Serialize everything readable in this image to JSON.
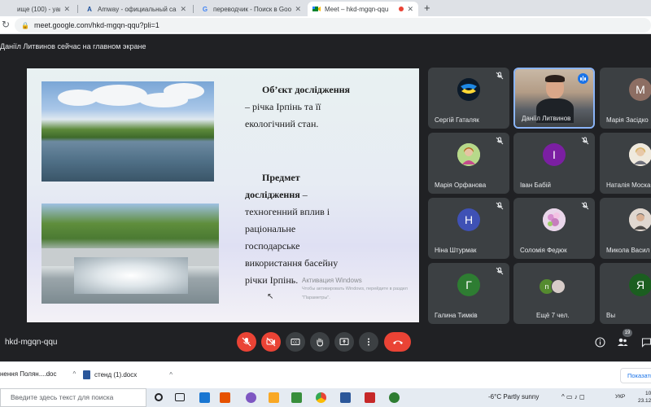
{
  "browser": {
    "tabs": [
      {
        "label": "ище (100) - yarad1964@g",
        "active": false
      },
      {
        "label": "Amway - официальный сайт и",
        "active": false
      },
      {
        "label": "переводчик - Поиск в Google",
        "active": false
      },
      {
        "label": "Meet – hkd-mgqn-qqu",
        "active": true
      }
    ],
    "url": "meet.google.com/hkd-mgqn-qqu?pli=1"
  },
  "meet": {
    "presenter_notice": "Даніїл Литвинов сейчас на главном экране",
    "meeting_code": "hkd-mgqn-qqu",
    "people_count": "19"
  },
  "slide": {
    "object_title": "Об’єкт дослідження",
    "object_lines": [
      "– річка Ірпінь та її",
      "екологічний стан."
    ],
    "subject_title": "Предмет",
    "subject_line1_bold": "дослідження",
    "subject_line1_rest": " –",
    "subject_lines": [
      "техногенний вплив і",
      "раціональне",
      "господарське",
      "використання басейну",
      "річки Ірпінь."
    ]
  },
  "watermark": {
    "title": "Активация Windows",
    "subtitle": "Чтобы активировать Windows, перейдите в раздел \"Параметры\"."
  },
  "participants": [
    {
      "name": "Сергій Гаталяк",
      "avatar": "logo",
      "muted": true
    },
    {
      "name": "Даніїл Литвинов",
      "avatar": "video",
      "speaking": true
    },
    {
      "name": "Марія Засідко",
      "avatar": "M",
      "color": "#8d6e63",
      "muted": false
    },
    {
      "name": "Марія Орфанова",
      "avatar": "photo",
      "muted": true
    },
    {
      "name": "Іван Бабій",
      "avatar": "I",
      "color": "#7b1fa2",
      "muted": true
    },
    {
      "name": "Наталія Моска",
      "avatar": "photo",
      "muted": false
    },
    {
      "name": "Ніна Штурмак",
      "avatar": "Н",
      "color": "#3f51b5",
      "muted": true
    },
    {
      "name": "Соломія Федюк",
      "avatar": "photo",
      "muted": true
    },
    {
      "name": "Микола Васил",
      "avatar": "photo",
      "muted": false
    },
    {
      "name": "Галина Тимків",
      "avatar": "Г",
      "color": "#2e7d32",
      "muted": true
    },
    {
      "name": "Ещё 7 чел.",
      "avatar": "group",
      "muted": false
    },
    {
      "name": "Вы",
      "avatar": "Я",
      "color": "#1b5e20",
      "muted": false
    }
  ],
  "downloads": [
    {
      "label": "нення Полян....doc"
    },
    {
      "label": "стенд (1).docx"
    }
  ],
  "show_all_label": "Показать",
  "taskbar": {
    "search_placeholder": "Введите здесь текст для поиска",
    "weather": "-6°C  Partly sunny",
    "lang": "УКР",
    "time": "10:4",
    "date": "23.12.2"
  },
  "colors": {
    "meet_bg": "#202124",
    "tile_bg": "#3c4043",
    "end_call_red": "#ea4335",
    "accent_blue": "#8ab4f8"
  }
}
